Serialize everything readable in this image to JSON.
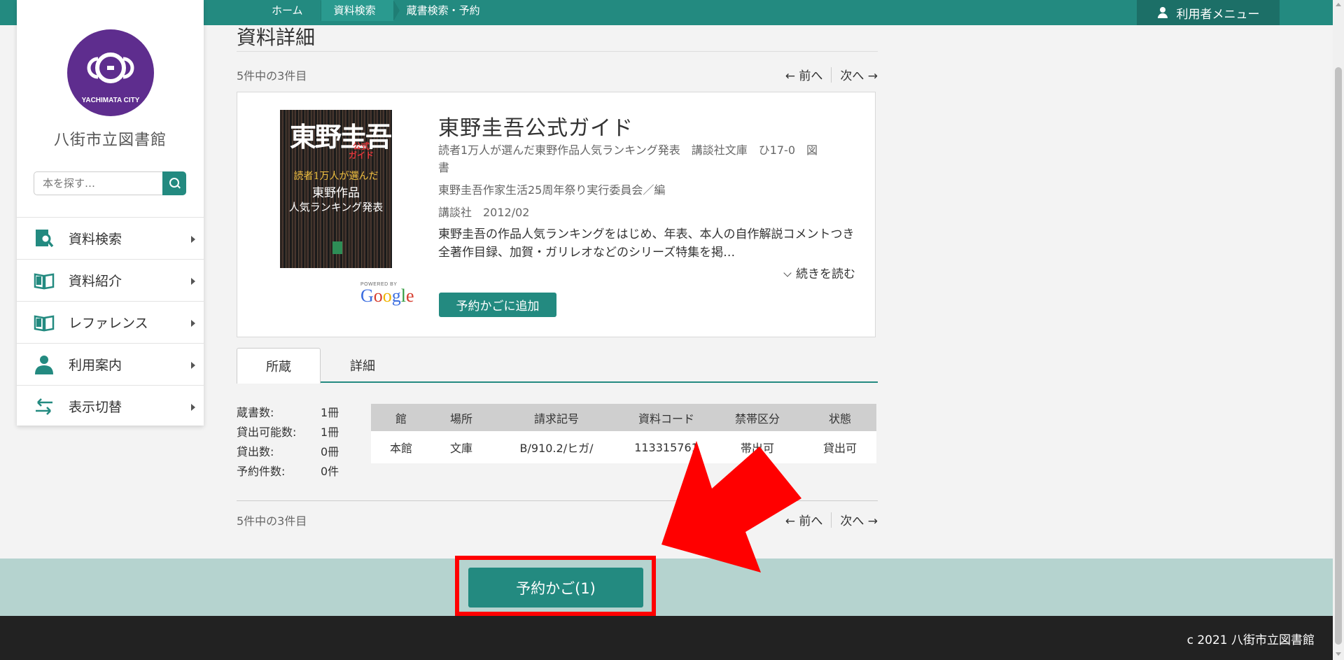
{
  "breadcrumb": [
    "ホーム",
    "資料検索",
    "蔵書検索・予約"
  ],
  "user_menu": {
    "label": "利用者メニュー",
    "icon": "user-icon"
  },
  "sidebar": {
    "logo_text": "YACHIMATA CITY",
    "library_name": "八街市立図書館",
    "search_placeholder": "本を探す…",
    "items": [
      {
        "label": "資料検索",
        "icon": "book-search-icon"
      },
      {
        "label": "資料紹介",
        "icon": "open-book-icon"
      },
      {
        "label": "レファレンス",
        "icon": "open-book-icon"
      },
      {
        "label": "利用案内",
        "icon": "person-icon"
      },
      {
        "label": "表示切替",
        "icon": "swap-icon"
      }
    ]
  },
  "main": {
    "title": "資料詳細",
    "counter": "5件中の3件目",
    "prev": "← 前へ",
    "next": "次へ →"
  },
  "book": {
    "title": "東野圭吾公式ガイド",
    "subtitle_line1": "読者1万人が選んだ東野作品人気ランキング発表　講談社文庫　ひ17-0　図",
    "subtitle_line2": "書",
    "author": "東野圭吾作家生活25周年祭り実行委員会／編",
    "publisher": "講談社　2012/02",
    "description": "東野圭吾の作品人気ランキングをはじめ、年表、本人の自作解説コメントつき全著作目録、加賀・ガリレオなどのシリーズ特集を掲…",
    "read_more": "続きを読む",
    "add_to_cart": "予約かごに追加",
    "powered_by": "POWERED BY",
    "google": "Google"
  },
  "tabs": [
    "所蔵",
    "詳細"
  ],
  "stats": [
    {
      "key": "蔵書数:",
      "value": "1冊"
    },
    {
      "key": "貸出可能数:",
      "value": "1冊"
    },
    {
      "key": "貸出数:",
      "value": "0冊"
    },
    {
      "key": "予約件数:",
      "value": "0件"
    }
  ],
  "holdings": {
    "headers": [
      "館",
      "場所",
      "請求記号",
      "資料コード",
      "禁帯区分",
      "状態"
    ],
    "rows": [
      [
        "本館",
        "文庫",
        "B/910.2/ヒガ/",
        "113315761",
        "帯出可",
        "貸出可"
      ]
    ]
  },
  "cart": {
    "label": "予約かご(1)"
  },
  "footer": {
    "copyright": "c 2021 八街市立図書館"
  },
  "colors": {
    "accent": "#238a80",
    "logo": "#5e2d8e",
    "highlight": "#ff0000"
  }
}
